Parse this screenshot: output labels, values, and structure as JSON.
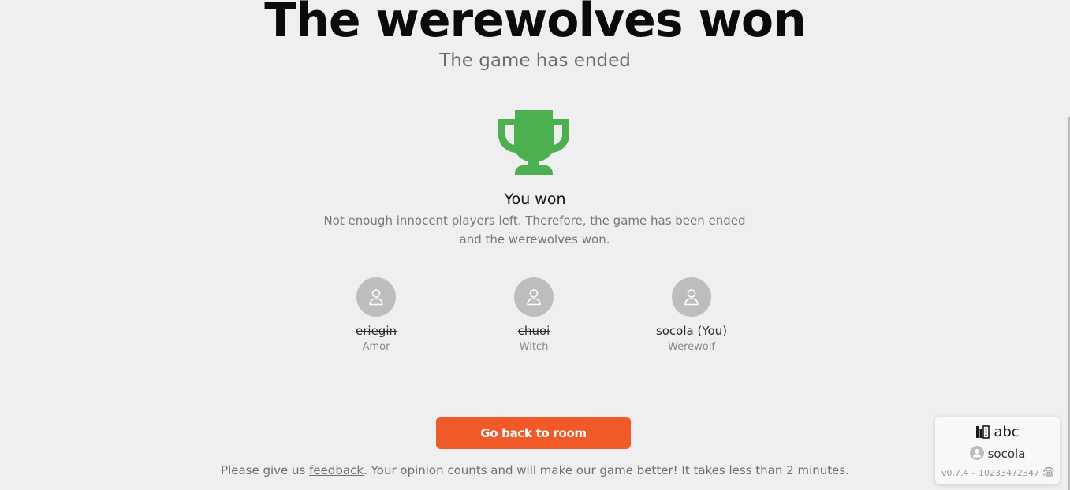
{
  "header": {
    "title": "The werewolves won",
    "subtitle": "The game has ended"
  },
  "result": {
    "icon": "trophy-icon",
    "title": "You won",
    "description_line1": "Not enough innocent players left. Therefore, the game has been ended",
    "description_line2": "and the werewolves won."
  },
  "players": [
    {
      "name": "eriegin",
      "role": "Amor",
      "dead": true
    },
    {
      "name": "chuoi",
      "role": "Witch",
      "dead": true
    },
    {
      "name": "socola (You)",
      "role": "Werewolf",
      "dead": false
    }
  ],
  "actions": {
    "back_label": "Go back to room"
  },
  "feedback": {
    "before": "Please give us ",
    "link": "feedback",
    "after": ". Your opinion counts and will make our game better! It takes less than 2 minutes."
  },
  "info_card": {
    "room_icon": "room-icon",
    "room_name": "abc",
    "user_icon": "user-icon",
    "username": "socola",
    "version": "v0.7.4 – 10233472347",
    "fingerprint_icon": "fingerprint-icon"
  },
  "colors": {
    "accent": "#f05a28",
    "trophy": "#4caf50",
    "background": "#efefef",
    "avatar": "#bdbdbd"
  }
}
